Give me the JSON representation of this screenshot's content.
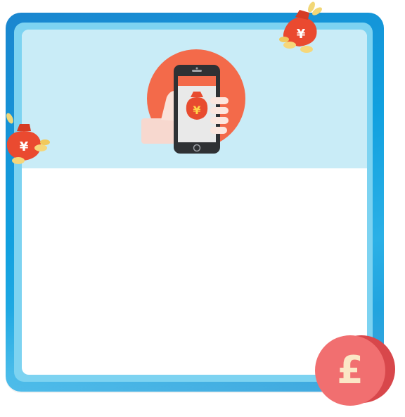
{
  "hero": {
    "currency_glyph": "¥",
    "icon": "phone-money-bag-icon"
  },
  "decorations": {
    "bag_glyph": "¥",
    "coin_glyph": "£",
    "icons": [
      "money-bag-icon",
      "pound-coin-icon"
    ]
  },
  "colors": {
    "frame_blue": "#1694d6",
    "inner_border": "#7dd3f1",
    "header_band": "#c9ecf7",
    "hero_circle": "#f36a4a",
    "bag_red": "#ea4a30",
    "coin_red": "#f06a6a",
    "coin_gold": "#f6d77a"
  }
}
